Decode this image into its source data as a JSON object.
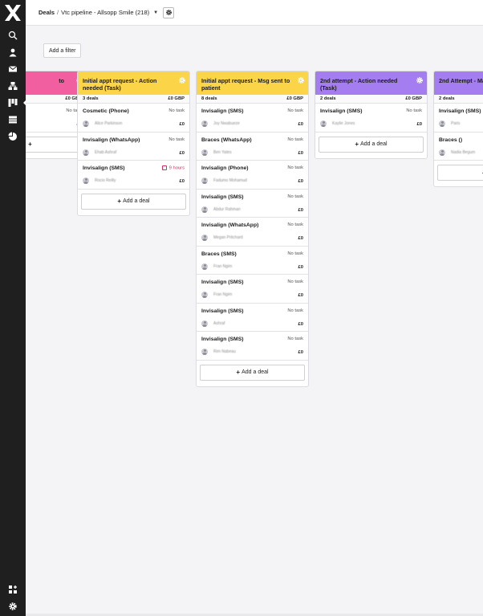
{
  "header": {
    "breadcrumb_root": "Deals",
    "breadcrumb_separator": "/",
    "pipeline_label": "Vtc pipeline - Allsopp Smile (218)"
  },
  "toolbar": {
    "filter_label": "Add a filter"
  },
  "sidebar": {
    "items": [
      {
        "icon": "search-icon"
      },
      {
        "icon": "contacts-icon"
      },
      {
        "icon": "inbox-icon"
      },
      {
        "icon": "org-chart-icon"
      },
      {
        "icon": "pipeline-board-icon",
        "active": true
      },
      {
        "icon": "table-icon"
      },
      {
        "icon": "reports-pie-icon"
      }
    ],
    "bottom": [
      {
        "icon": "apps-icon"
      },
      {
        "icon": "settings-gear-icon"
      }
    ]
  },
  "colors": {
    "pink": "#f25fa1",
    "yellow": "#fbd448",
    "purple": "#a47ef0",
    "sidebar": "#1f1f1f",
    "overdue": "#d4315f"
  },
  "columns": [
    {
      "title": "to",
      "color": "pink",
      "count": "",
      "total": "£0 GBP",
      "cards": [
        {
          "title": "",
          "task": "No task",
          "person": "",
          "value": "£0"
        }
      ],
      "add_label": ""
    },
    {
      "title": "Initial appt request - Action needed (Task)",
      "color": "yellow",
      "count": "3 deals",
      "total": "£0 GBP",
      "cards": [
        {
          "title": "Cosmetic (Phone)",
          "task": "No task",
          "person": "Alice Parkinson",
          "value": "£0"
        },
        {
          "title": "Invisalign (WhatsApp)",
          "task": "No task",
          "person": "Ehab Ashraf",
          "value": "£0"
        },
        {
          "title": "Invisalign (SMS)",
          "task": "9 hours",
          "overdue": true,
          "person": "Rocio Reilly",
          "value": "£0"
        }
      ],
      "add_label": "Add a deal"
    },
    {
      "title": "Initial appt request - Msg sent to patient",
      "color": "yellow",
      "count": "8 deals",
      "total": "£0 GBP",
      "cards": [
        {
          "title": "Invisalign (SMS)",
          "task": "No task",
          "person": "Joy Nwabueze",
          "value": "£0"
        },
        {
          "title": "Braces (WhatsApp)",
          "task": "No task",
          "person": "Ben Yates",
          "value": "£0"
        },
        {
          "title": "Invisalign (Phone)",
          "task": "No task",
          "person": "Fadumo Mohamud",
          "value": "£0"
        },
        {
          "title": "Invisalign (SMS)",
          "task": "No task",
          "person": "Abdur Rahman",
          "value": "£0"
        },
        {
          "title": "Invisalign (WhatsApp)",
          "task": "No task",
          "person": "Megan Pritchard",
          "value": "£0"
        },
        {
          "title": "Braces (SMS)",
          "task": "No task",
          "person": "Fran Ngim",
          "value": "£0"
        },
        {
          "title": "Invisalign (SMS)",
          "task": "No task",
          "person": "Fran Ngim",
          "value": "£0"
        },
        {
          "title": "Invisalign (SMS)",
          "task": "No task",
          "person": "Ashraf",
          "value": "£0"
        },
        {
          "title": "Invisalign (SMS)",
          "task": "No task",
          "person": "Rim Nabeau",
          "value": "£0"
        }
      ],
      "add_label": "Add a deal"
    },
    {
      "title": "2nd attempt - Action needed (Task)",
      "color": "purple",
      "count": "2 deals",
      "total": "£0 GBP",
      "cards": [
        {
          "title": "Invisalign (SMS)",
          "task": "No task",
          "person": "Kaylie Jones",
          "value": "£0"
        }
      ],
      "add_label": "Add a deal"
    },
    {
      "title": "2nd Attempt - Ma",
      "color": "purple",
      "count": "2 deals",
      "total": "",
      "cards": [
        {
          "title": "Invisalign (SMS)",
          "task": "",
          "person": "Paris",
          "value": ""
        },
        {
          "title": "Braces ()",
          "task": "",
          "person": "Nadia Begum",
          "value": ""
        }
      ],
      "add_label": "Add"
    }
  ]
}
